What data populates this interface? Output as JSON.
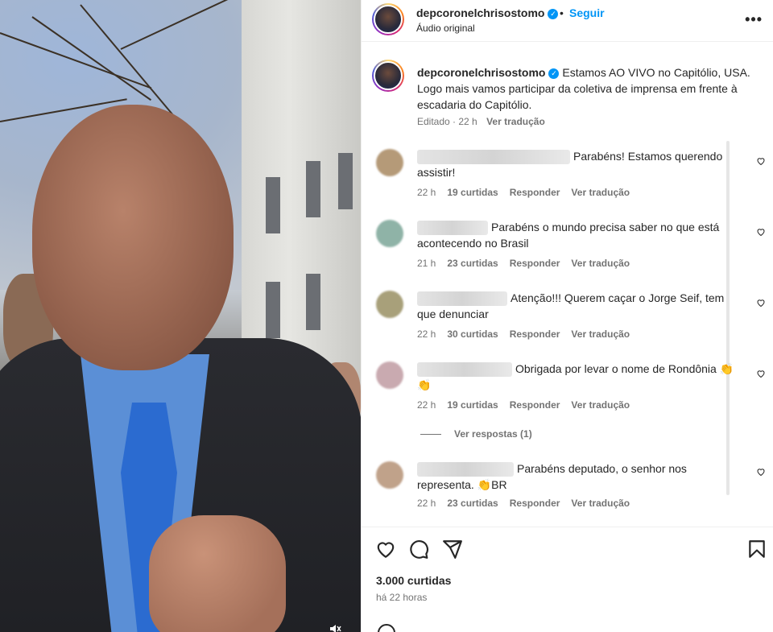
{
  "post": {
    "username": "depcoronelchrisostomo",
    "follow_label": "Seguir",
    "separator": "•",
    "audio": "Áudio original",
    "more_label": "•••"
  },
  "caption": {
    "username": "depcoronelchrisostomo",
    "text": "Estamos AO VIVO no Capitólio, USA. Logo mais vamos participar da coletiva de imprensa em frente à escadaria do Capitólio.",
    "edited": "Editado",
    "time": "22 h",
    "translate": "Ver tradução"
  },
  "comments": [
    {
      "text": "Parabéns! Estamos querendo assistir!",
      "time": "22 h",
      "likes": "19 curtidas",
      "reply": "Responder",
      "translate": "Ver tradução",
      "avatar_color": "#b59a78"
    },
    {
      "text": "Parabéns o mundo precisa saber no que está acontecendo no Brasil",
      "time": "21 h",
      "likes": "23 curtidas",
      "reply": "Responder",
      "translate": "Ver tradução",
      "avatar_color": "#8fb3a7"
    },
    {
      "text": "Atenção!!! Querem caçar o Jorge Seif, tem que denunciar",
      "time": "22 h",
      "likes": "30 curtidas",
      "reply": "Responder",
      "translate": "Ver tradução",
      "avatar_color": "#a8a07a"
    },
    {
      "text": "Obrigada por levar o nome de Rondônia 👏 👏",
      "time": "22 h",
      "likes": "19 curtidas",
      "reply": "Responder",
      "translate": "Ver tradução",
      "avatar_color": "#c9aab0"
    },
    {
      "text": "Parabéns deputado, o senhor nos representa. 👏BR",
      "time": "22 h",
      "likes": "23 curtidas",
      "reply": "Responder",
      "translate": "Ver tradução",
      "avatar_color": "#c0a28a"
    }
  ],
  "replies_label": "Ver respostas (1)",
  "footer": {
    "likes": "3.000 curtidas",
    "time": "há 22 horas"
  },
  "icons": {
    "like": "heart-icon",
    "comment": "comment-icon",
    "share": "share-icon",
    "save": "bookmark-icon",
    "verified": "verified-badge-icon",
    "mute": "muted-speaker-icon"
  },
  "colors": {
    "accent": "#0095f6",
    "text": "#262626",
    "secondary": "#737373"
  }
}
